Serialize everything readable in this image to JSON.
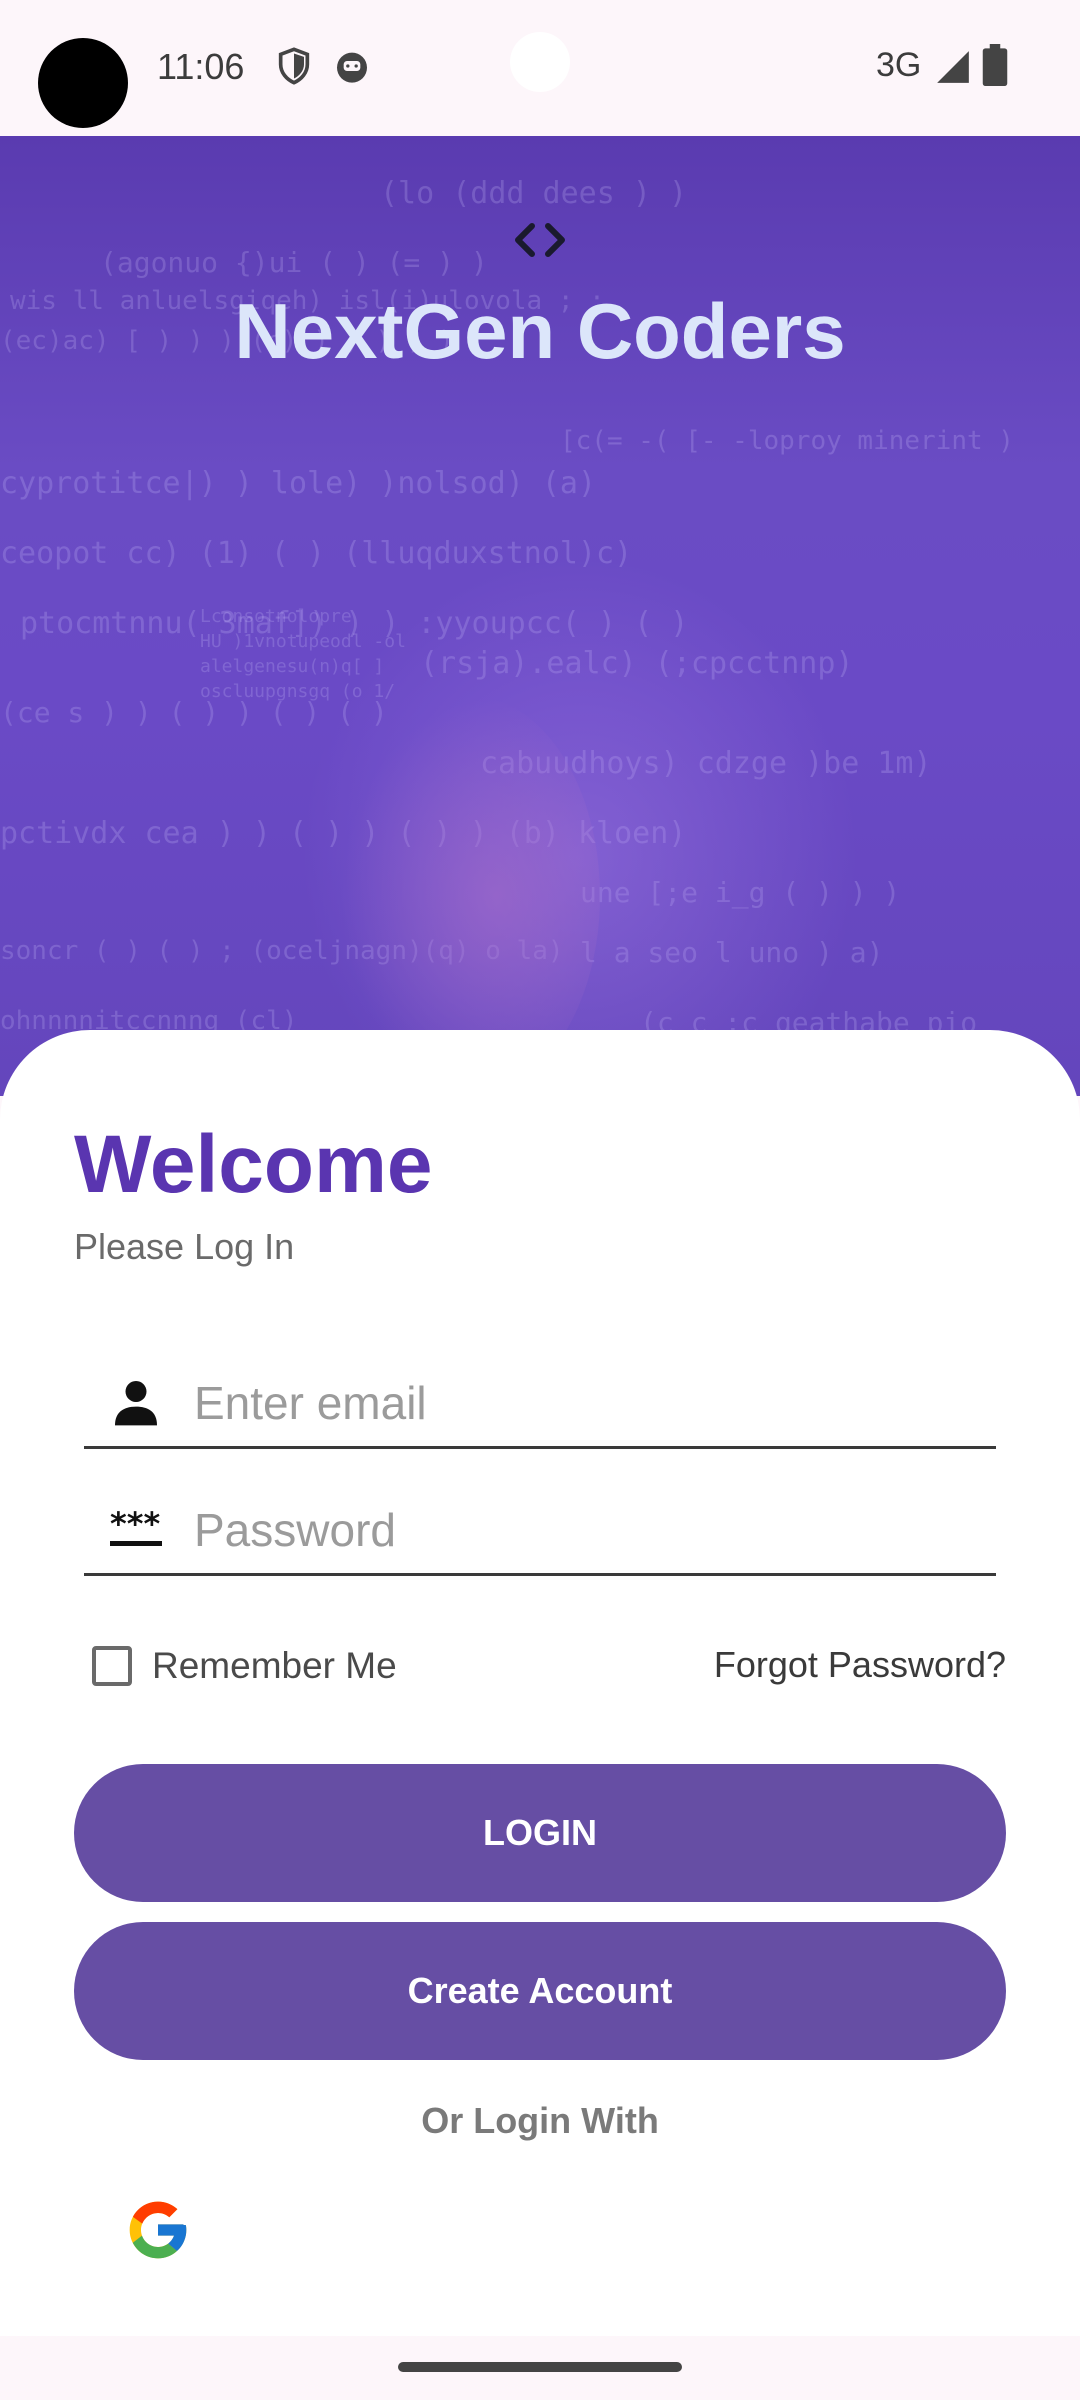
{
  "status_bar": {
    "time": "11:06",
    "network": "3G",
    "icons": [
      "shield-icon",
      "cat-face-icon",
      "signal-icon",
      "battery-icon"
    ]
  },
  "hero": {
    "brand_icon": "code-brackets-icon",
    "title": "NextGen Coders"
  },
  "login": {
    "heading": "Welcome",
    "subheading": "Please Log In",
    "email_placeholder": "Enter email",
    "password_placeholder": "Password",
    "remember_label": "Remember Me",
    "remember_checked": false,
    "forgot_label": "Forgot Password?",
    "login_button": "LOGIN",
    "create_account_button": "Create Account",
    "alt_login_label": "Or Login With",
    "social": [
      "google-icon"
    ]
  },
  "colors": {
    "accent": "#5a35b0",
    "button": "#664ea4",
    "hero": "#6a4cc4",
    "title": "#dce6fa"
  }
}
